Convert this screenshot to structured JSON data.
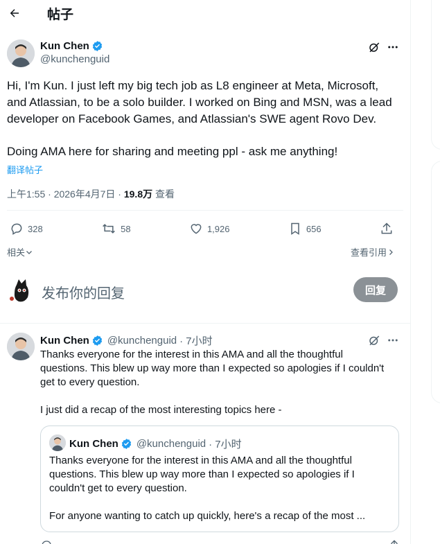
{
  "header": {
    "title": "帖子"
  },
  "post": {
    "author_name": "Kun Chen",
    "author_handle": "@kunchenguid",
    "body_lines": [
      "Hi, I'm Kun. I just left my big tech job as L8 engineer at Meta, Microsoft,",
      "and Atlassian, to be a solo builder. I worked on Bing and MSN, was a lead",
      "developer on Facebook Games, and Atlassian's SWE agent Rovo Dev.",
      "",
      "Doing AMA here for sharing and meeting ppl - ask me anything!"
    ],
    "translate_label": "翻译帖子",
    "time": "上午1:55 · 2026年4月7日 · ",
    "views_count": "19.8万",
    "views_label": " 查看",
    "stats": {
      "replies": "328",
      "reposts": "58",
      "likes": "1,926",
      "bookmarks": "656"
    },
    "related_label": "相关",
    "quotes_label": "查看引用"
  },
  "composer": {
    "placeholder": "发布你的回复",
    "reply_button": "回复"
  },
  "reply": {
    "author_name": "Kun Chen",
    "author_handle": "@kunchenguid",
    "time": "· 7小时",
    "lines": [
      "Thanks everyone for the interest in this AMA and all the thoughtful",
      "questions. This blew up way more than I expected so apologies if I couldn't",
      "get to every question.",
      "",
      "I just did a recap of the most interesting topics here -"
    ],
    "quote": {
      "author_name": "Kun Chen",
      "author_handle": "@kunchenguid",
      "time": "· 7小时",
      "lines": [
        "Thanks everyone for the interest in this AMA and all the thoughtful",
        "questions. This blew up way more than I expected so apologies if I",
        "couldn't get to every question.",
        "",
        "For anyone wanting to catch up quickly, here's a recap of the most ..."
      ]
    }
  },
  "colors": {
    "accent": "#1d9bf0",
    "secondary_text": "#536471",
    "reply_button_bg": "#8b9196"
  }
}
